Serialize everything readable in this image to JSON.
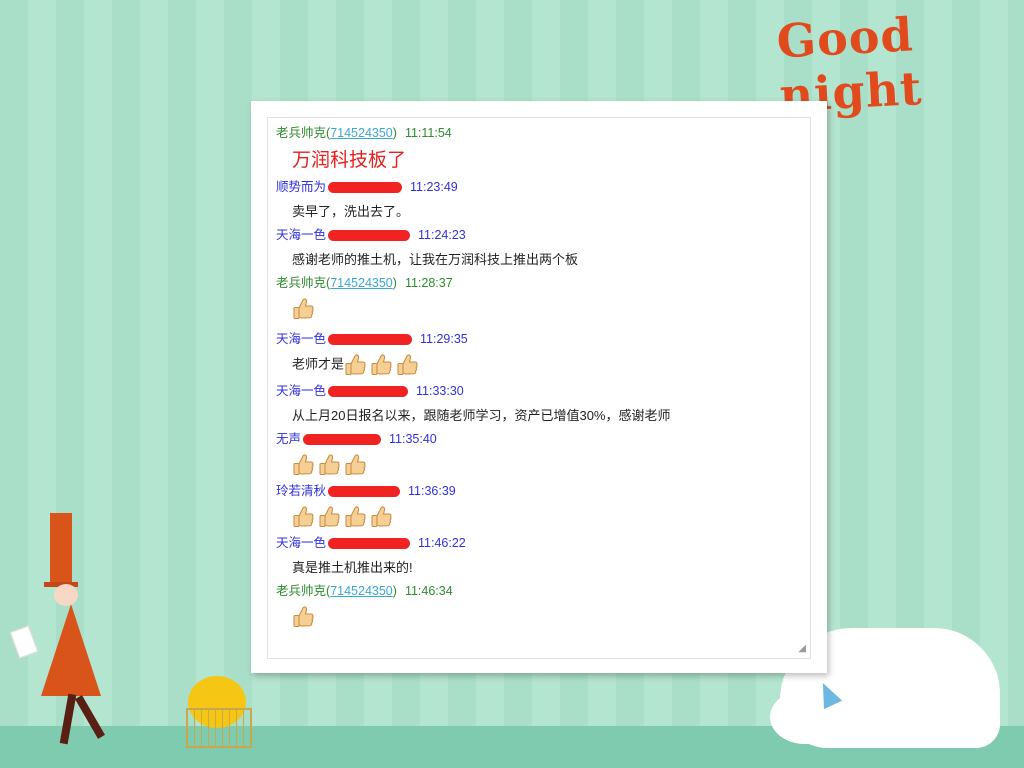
{
  "banner": {
    "text": "Good night"
  },
  "thumb_icon": "thumbs-up-emoji",
  "messages": [
    {
      "sender": "老兵帅克",
      "qq": "714524350",
      "time": "11:11:54",
      "text": "万润科技板了",
      "color": "green",
      "big": true,
      "thumbs": 0,
      "redacted": false
    },
    {
      "sender": "顺势而为",
      "qq": "",
      "time": "11:23:49",
      "text": "卖早了，洗出去了。",
      "color": "blue",
      "big": false,
      "thumbs": 0,
      "redacted": true
    },
    {
      "sender": "天海一色",
      "qq": "",
      "time": "11:24:23",
      "text": "感谢老师的推土机，让我在万润科技上推出两个板",
      "color": "blue",
      "big": false,
      "thumbs": 0,
      "redacted": true
    },
    {
      "sender": "老兵帅克",
      "qq": "714524350",
      "time": "11:28:37",
      "text": "",
      "color": "green",
      "big": false,
      "thumbs": 1,
      "redacted": false
    },
    {
      "sender": "天海一色",
      "qq": "",
      "time": "11:29:35",
      "text": "老师才是",
      "color": "blue",
      "big": false,
      "thumbs": 3,
      "redacted": true
    },
    {
      "sender": "天海一色",
      "qq": "",
      "time": "11:33:30",
      "text": "从上月20日报名以来，跟随老师学习，资产已增值30%，感谢老师",
      "color": "blue",
      "big": false,
      "thumbs": 0,
      "redacted": true
    },
    {
      "sender": "无声",
      "qq": "",
      "time": "11:35:40",
      "text": "",
      "color": "blue",
      "big": false,
      "thumbs": 3,
      "redacted": true
    },
    {
      "sender": "玲若清秋",
      "qq": "",
      "time": "11:36:39",
      "text": "",
      "color": "blue",
      "big": false,
      "thumbs": 4,
      "redacted": true
    },
    {
      "sender": "天海一色",
      "qq": "",
      "time": "11:46:22",
      "text": "真是推土机推出来的!",
      "color": "blue",
      "big": false,
      "thumbs": 0,
      "redacted": true
    },
    {
      "sender": "老兵帅克",
      "qq": "714524350",
      "time": "11:46:34",
      "text": "",
      "color": "green",
      "big": false,
      "thumbs": 1,
      "redacted": false
    }
  ]
}
